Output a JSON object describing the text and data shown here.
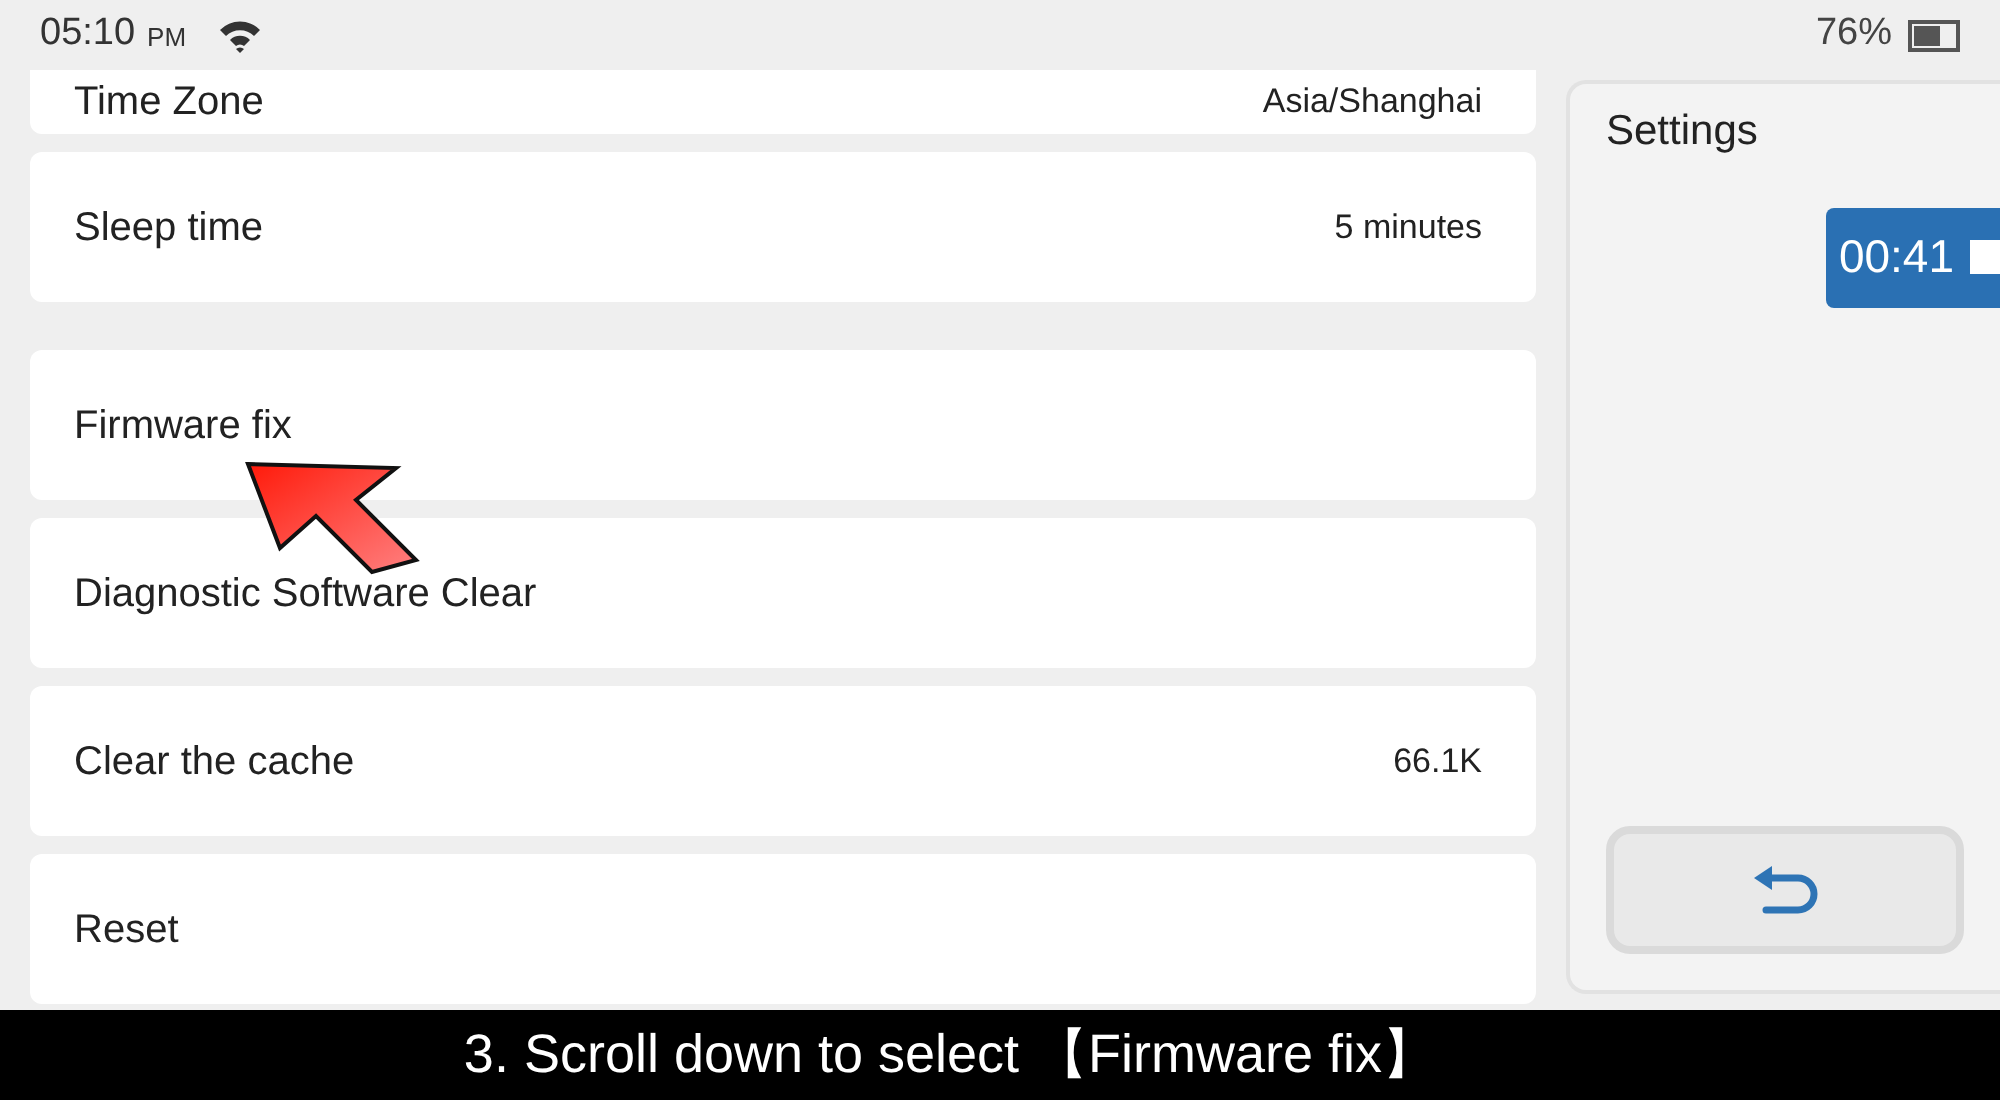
{
  "status_bar": {
    "time": "05:10",
    "period": "PM",
    "battery": "76%"
  },
  "settings_list": [
    {
      "label": "Time Zone",
      "value": "Asia/Shanghai"
    },
    {
      "label": "Sleep time",
      "value": "5 minutes"
    },
    {
      "label": "Firmware fix"
    },
    {
      "label": "Diagnostic Software Clear"
    },
    {
      "label": "Clear the cache",
      "value": "66.1K"
    },
    {
      "label": "Reset"
    }
  ],
  "side_panel": {
    "title": "Settings",
    "timer": "00:41"
  },
  "caption": "3. Scroll down to select 【Firmware fix】"
}
